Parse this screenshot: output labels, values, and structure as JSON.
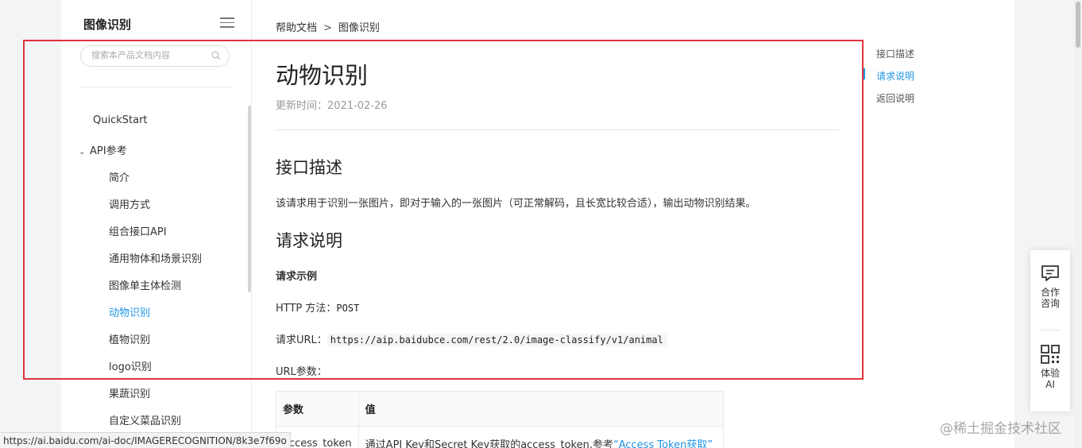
{
  "sidebar": {
    "title": "图像识别",
    "search_placeholder": "搜索本产品文档内容",
    "items": [
      {
        "label": "QuickStart"
      },
      {
        "label": "API参考"
      },
      {
        "label": "简介"
      },
      {
        "label": "调用方式"
      },
      {
        "label": "组合接口API"
      },
      {
        "label": "通用物体和场景识别"
      },
      {
        "label": "图像单主体检测"
      },
      {
        "label": "动物识别"
      },
      {
        "label": "植物识别"
      },
      {
        "label": "logo识别"
      },
      {
        "label": "果蔬识别"
      },
      {
        "label": "自定义菜品识别"
      }
    ],
    "active_item": "动物识别"
  },
  "breadcrumb": {
    "items": [
      "帮助文档",
      "图像识别"
    ],
    "separator": ">"
  },
  "doc": {
    "title": "动物识别",
    "updated": "更新时间：2021-02-26",
    "section1_title": "接口描述",
    "section1_text": "该请求用于识别一张图片，即对于输入的一张图片（可正常解码，且长宽比较合适），输出动物识别结果。",
    "section2_title": "请求说明",
    "request_example_label": "请求示例",
    "http_method_label": "HTTP 方法：",
    "http_method_value": "POST",
    "request_url_label": "请求URL：",
    "request_url_value": "https://aip.baidubce.com/rest/2.0/image-classify/v1/animal",
    "url_params_label": "URL参数：",
    "table": {
      "headers": [
        "参数",
        "值"
      ],
      "rows": [
        {
          "param": "access_token",
          "value_prefix": "通过API Key和Secret Key获取的access_token,参考",
          "value_link": "“Access Token获取”"
        }
      ]
    }
  },
  "toc": {
    "items": [
      "接口描述",
      "请求说明",
      "返回说明"
    ],
    "active": "请求说明"
  },
  "float_panel": {
    "consult_label_1": "合作",
    "consult_label_2": "咨询",
    "ai_label_1": "体验",
    "ai_label_2": "AI"
  },
  "status_url": "https://ai.baidu.com/ai-doc/IMAGERECOGNITION/8k3e7f69o",
  "watermark": "@稀土掘金技术社区",
  "colors": {
    "accent": "#2196e6",
    "highlight_border": "#e0313c"
  }
}
